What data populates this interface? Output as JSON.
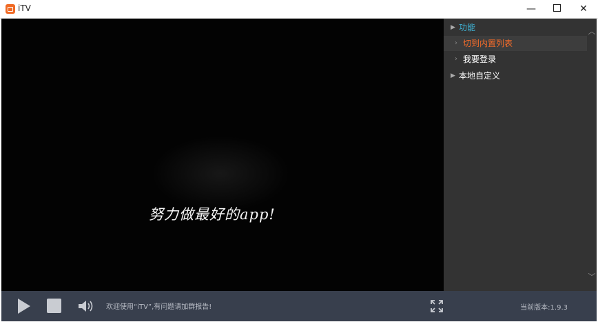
{
  "window": {
    "title": "iTV",
    "minimize": "—",
    "close": "✕"
  },
  "video": {
    "caption": "努力做最好的app!"
  },
  "panel": {
    "items": [
      {
        "label": "功能"
      },
      {
        "label": "切到内置列表"
      },
      {
        "label": "我要登录"
      },
      {
        "label": "本地自定义"
      }
    ],
    "scroll_up": "︿",
    "scroll_down": "﹀"
  },
  "controls": {
    "status_text": "欢迎使用“iTV”,有问题请加群报告!",
    "version_text": "当前版本:1.9.3"
  },
  "colors": {
    "accent_blue": "#3fb6d9",
    "accent_orange": "#f26b2a",
    "control_bar": "#383f4d",
    "panel": "#333333"
  },
  "icons": [
    "itv-logo-icon",
    "play-icon",
    "stop-icon",
    "volume-icon",
    "fullscreen-icon"
  ]
}
